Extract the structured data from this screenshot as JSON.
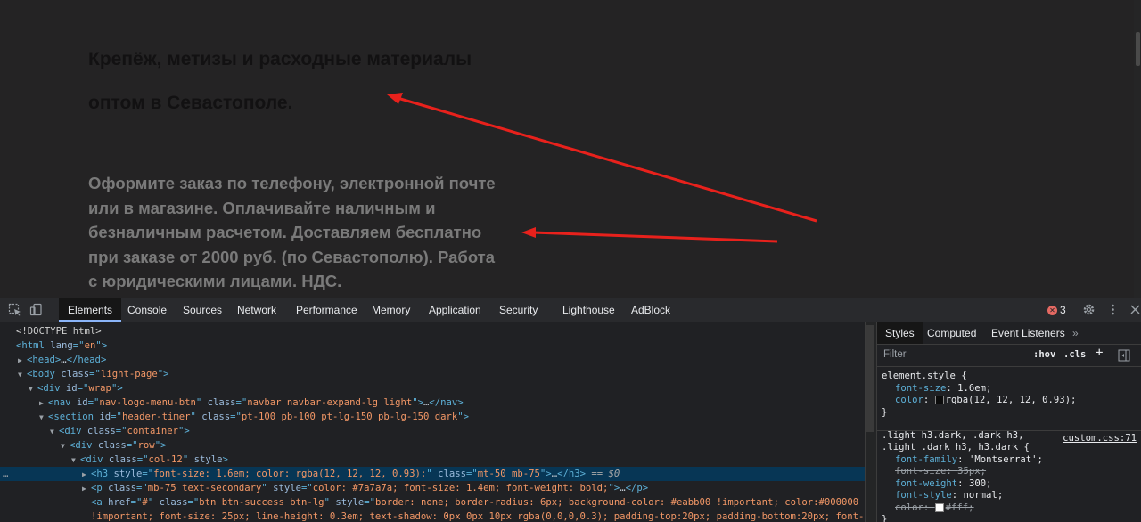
{
  "page": {
    "heading_line1": "Крепёж, метизы и расходные материалы",
    "heading_line2": "оптом в Севастополе.",
    "paragraph_lines": [
      "Оформите заказ по телефону, электронной почте",
      "или в магазине. Оплачивайте наличным и",
      "безналичным расчетом. Доставляем бесплатно",
      "при заказе от 2000 руб. (по Севастополю). Работа",
      "с юридическими лицами. НДС."
    ],
    "annotation_color": "#e8211c"
  },
  "devtools": {
    "tabs": [
      "Elements",
      "Console",
      "Sources",
      "Network",
      "Performance",
      "Memory",
      "Application",
      "Security",
      "Lighthouse",
      "AdBlock"
    ],
    "error_count": "3",
    "dom_rows": [
      {
        "indent": 0,
        "tri": "",
        "t": [
          [
            "tx",
            "<!DOCTYPE html>"
          ]
        ]
      },
      {
        "indent": 0,
        "tri": "",
        "t": [
          [
            "tg",
            "<html "
          ],
          [
            "an",
            "lang"
          ],
          [
            "tg",
            "=\""
          ],
          [
            "av",
            "en"
          ],
          [
            "tg",
            "\">"
          ]
        ]
      },
      {
        "indent": 1,
        "tri": "▶",
        "t": [
          [
            "tg",
            "<head>"
          ],
          [
            "dots",
            "…"
          ],
          [
            "tg",
            "</head>"
          ]
        ]
      },
      {
        "indent": 1,
        "tri": "▼",
        "t": [
          [
            "tg",
            "<body "
          ],
          [
            "an",
            "class"
          ],
          [
            "tg",
            "=\""
          ],
          [
            "av",
            "light-page"
          ],
          [
            "tg",
            "\">"
          ]
        ]
      },
      {
        "indent": 2,
        "tri": "▼",
        "t": [
          [
            "tg",
            "<div "
          ],
          [
            "an",
            "id"
          ],
          [
            "tg",
            "=\""
          ],
          [
            "av",
            "wrap"
          ],
          [
            "tg",
            "\">"
          ]
        ]
      },
      {
        "indent": 3,
        "tri": "▶",
        "t": [
          [
            "tg",
            "<nav "
          ],
          [
            "an",
            "id"
          ],
          [
            "tg",
            "=\""
          ],
          [
            "av",
            "nav-logo-menu-btn"
          ],
          [
            "tg",
            "\" "
          ],
          [
            "an",
            "class"
          ],
          [
            "tg",
            "=\""
          ],
          [
            "av",
            "navbar navbar-expand-lg light"
          ],
          [
            "tg",
            "\">"
          ],
          [
            "dots",
            "…"
          ],
          [
            "tg",
            "</nav>"
          ]
        ]
      },
      {
        "indent": 3,
        "tri": "▼",
        "t": [
          [
            "tg",
            "<section "
          ],
          [
            "an",
            "id"
          ],
          [
            "tg",
            "=\""
          ],
          [
            "av",
            "header-timer"
          ],
          [
            "tg",
            "\" "
          ],
          [
            "an",
            "class"
          ],
          [
            "tg",
            "=\""
          ],
          [
            "av",
            "pt-100 pb-100 pt-lg-150 pb-lg-150 dark"
          ],
          [
            "tg",
            "\">"
          ]
        ]
      },
      {
        "indent": 4,
        "tri": "▼",
        "t": [
          [
            "tg",
            "<div "
          ],
          [
            "an",
            "class"
          ],
          [
            "tg",
            "=\""
          ],
          [
            "av",
            "container"
          ],
          [
            "tg",
            "\">"
          ]
        ]
      },
      {
        "indent": 5,
        "tri": "▼",
        "t": [
          [
            "tg",
            "<div "
          ],
          [
            "an",
            "class"
          ],
          [
            "tg",
            "=\""
          ],
          [
            "av",
            "row"
          ],
          [
            "tg",
            "\">"
          ]
        ]
      },
      {
        "indent": 6,
        "tri": "▼",
        "t": [
          [
            "tg",
            "<div "
          ],
          [
            "an",
            "class"
          ],
          [
            "tg",
            "=\""
          ],
          [
            "av",
            "col-12"
          ],
          [
            "tg",
            "\" "
          ],
          [
            "an",
            "style"
          ],
          [
            "tg",
            ">"
          ]
        ]
      },
      {
        "indent": 7,
        "tri": "▶",
        "sel": true,
        "t": [
          [
            "tg",
            "<h3 "
          ],
          [
            "an",
            "style"
          ],
          [
            "tg",
            "=\""
          ],
          [
            "av",
            "font-size: 1.6em; color: rgba(12, 12, 12, 0.93);"
          ],
          [
            "tg",
            "\" "
          ],
          [
            "an",
            "class"
          ],
          [
            "tg",
            "=\""
          ],
          [
            "av",
            "mt-50 mb-75"
          ],
          [
            "tg",
            "\">"
          ],
          [
            "dots",
            "…"
          ],
          [
            "tg",
            "</h3>"
          ],
          [
            "eq",
            " == $0"
          ]
        ]
      },
      {
        "indent": 7,
        "tri": "▶",
        "t": [
          [
            "tg",
            "<p "
          ],
          [
            "an",
            "class"
          ],
          [
            "tg",
            "=\""
          ],
          [
            "av",
            "mb-75 text-secondary"
          ],
          [
            "tg",
            "\" "
          ],
          [
            "an",
            "style"
          ],
          [
            "tg",
            "=\""
          ],
          [
            "av",
            "color: #7a7a7a; font-size: 1.4em; font-weight: bold;"
          ],
          [
            "tg",
            "\">"
          ],
          [
            "dots",
            "…"
          ],
          [
            "tg",
            "</p>"
          ]
        ]
      },
      {
        "indent": 7,
        "tri": "",
        "t": [
          [
            "tg",
            "<a "
          ],
          [
            "an",
            "href"
          ],
          [
            "tg",
            "=\""
          ],
          [
            "av",
            "#"
          ],
          [
            "tg",
            "\" "
          ],
          [
            "an",
            "class"
          ],
          [
            "tg",
            "=\""
          ],
          [
            "av",
            "btn btn-success btn-lg"
          ],
          [
            "tg",
            "\" "
          ],
          [
            "an",
            "style"
          ],
          [
            "tg",
            "=\""
          ],
          [
            "av",
            "border: none; border-radius: 6px; background-color: #eabb00 !important; color:#000000"
          ]
        ]
      },
      {
        "indent": 7,
        "tri": "",
        "t": [
          [
            "av",
            "!important; font-size: 25px; line-height: 0.3em; text-shadow: 0px 0px 10px rgba(0,0,0,0.3); padding-top:20px; padding-bottom:20px; font-"
          ]
        ]
      }
    ],
    "styles_tabs": [
      "Styles",
      "Computed",
      "Event Listeners"
    ],
    "filter_placeholder": "Filter",
    "hov_label": ":hov",
    "cls_label": ".cls",
    "element_style": {
      "selector": "element.style {",
      "props": [
        {
          "name": "font-size",
          "value": "1.6em;"
        },
        {
          "name": "color",
          "value": "rgba(12, 12, 12, 0.93);",
          "swatch": "#0c0c0c"
        }
      ],
      "close": "}"
    },
    "rule2": {
      "selector_line1": ".light h3.dark, .dark h3,",
      "selector_line2": ".light .dark h3, h3.dark {",
      "source": "custom.css:71",
      "props": [
        {
          "name": "font-family",
          "value": "'Montserrat';"
        },
        {
          "name": "font-size",
          "value": "35px;",
          "struck": true
        },
        {
          "name": "font-weight",
          "value": "300;"
        },
        {
          "name": "font-style",
          "value": "normal;"
        },
        {
          "name": "color",
          "value": "#fff;",
          "struck": true,
          "swatch": "#ffffff"
        }
      ],
      "close": "}"
    }
  }
}
